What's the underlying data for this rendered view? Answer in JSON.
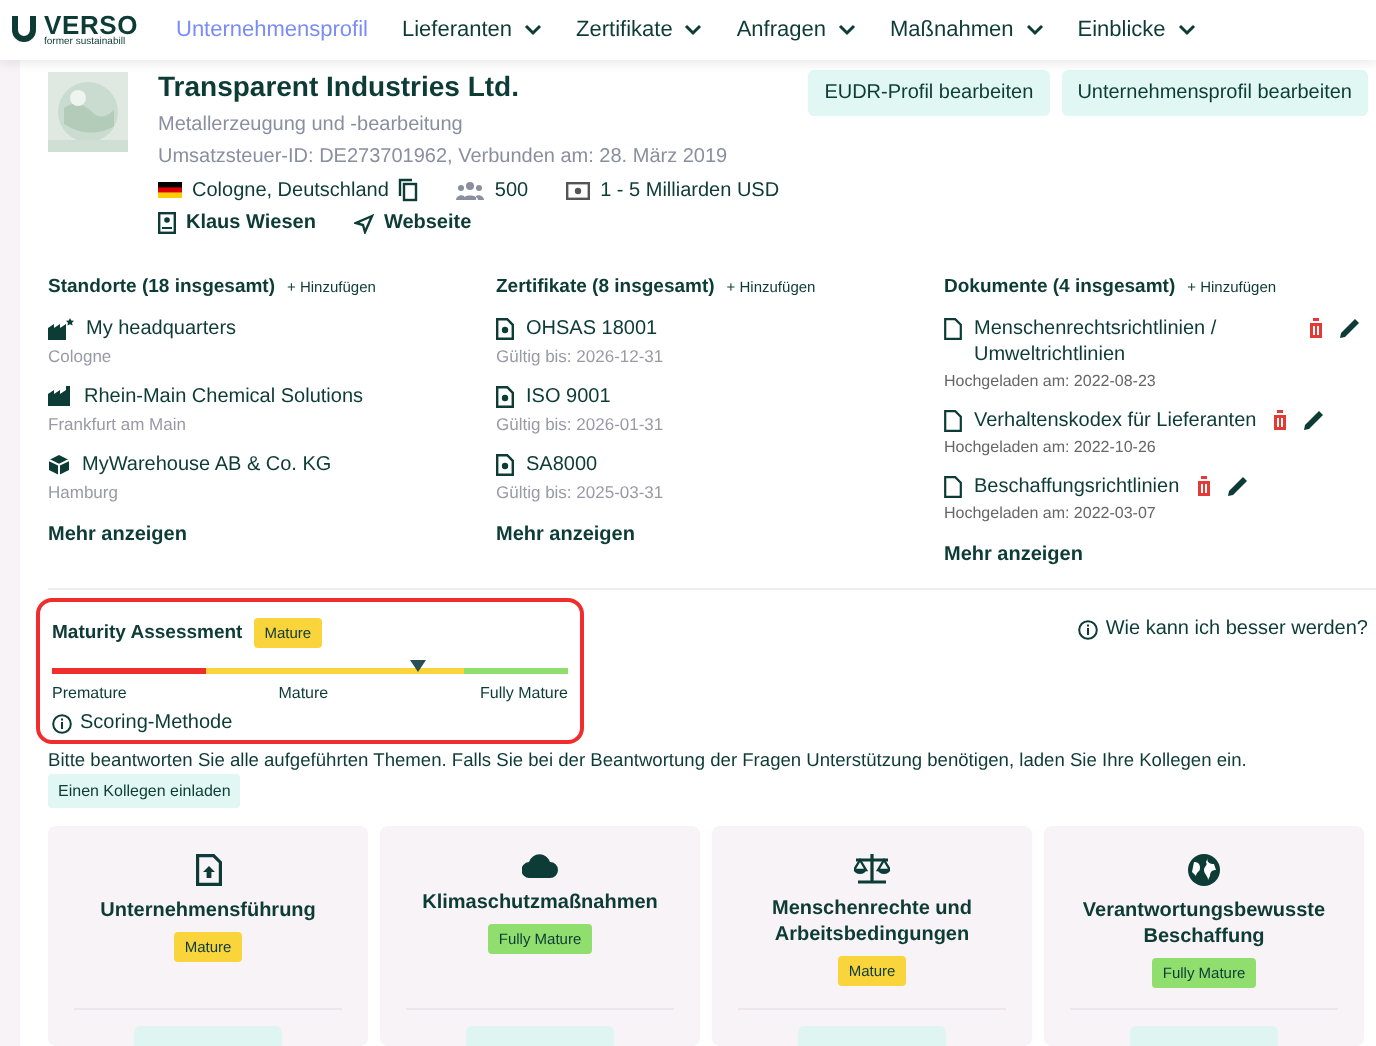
{
  "header": {
    "logo": "VERSO",
    "tagline": "former sustainabill",
    "nav": [
      {
        "label": "Unternehmensprofil",
        "selected": true,
        "dropdown": false
      },
      {
        "label": "Lieferanten",
        "selected": false,
        "dropdown": true
      },
      {
        "label": "Zertifikate",
        "selected": false,
        "dropdown": true
      },
      {
        "label": "Anfragen",
        "selected": false,
        "dropdown": true
      },
      {
        "label": "Maßnahmen",
        "selected": false,
        "dropdown": true
      },
      {
        "label": "Einblicke",
        "selected": false,
        "dropdown": true
      }
    ]
  },
  "company": {
    "name": "Transparent Industries Ltd.",
    "industry": "Metallerzeugung und -bearbeitung",
    "vat": "Umsatzsteuer-ID: DE273701962, Verbunden am: 28. März 2019",
    "location": "Cologne, Deutschland",
    "employees": "500",
    "revenue": "1 - 5 Milliarden USD",
    "contact": "Klaus Wiesen",
    "website": "Webseite",
    "buttons": [
      "EUDR-Profil bearbeiten",
      "Unternehmensprofil bearbeiten"
    ]
  },
  "sections": [
    {
      "kind": "locations",
      "title": "Standorte (18 insgesamt)",
      "add": "+ Hinzufügen",
      "more": "Mehr anzeigen",
      "items": [
        {
          "kind": "headquarters",
          "name": "My headquarters",
          "sub": "Cologne"
        },
        {
          "kind": "factory",
          "name": "Rhein-Main Chemical Solutions",
          "sub": "Frankfurt am Main"
        },
        {
          "kind": "warehouse",
          "name": "MyWarehouse AB & Co. KG",
          "sub": "Hamburg"
        }
      ]
    },
    {
      "kind": "certificates",
      "title": "Zertifikate (8 insgesamt)",
      "add": "+ Hinzufügen",
      "more": "Mehr anzeigen",
      "items": [
        {
          "kind": "certificate",
          "name": "OHSAS 18001",
          "sub": "Gültig bis: 2026-12-31"
        },
        {
          "kind": "certificate",
          "name": "ISO 9001",
          "sub": "Gültig bis: 2026-01-31"
        },
        {
          "kind": "certificate",
          "name": "SA8000",
          "sub": "Gültig bis: 2025-03-31"
        }
      ]
    },
    {
      "kind": "documents",
      "title": "Dokumente (4 insgesamt)",
      "add": "+ Hinzufügen",
      "more": "Mehr anzeigen",
      "items": [
        {
          "kind": "document",
          "name": "Menschenrechtsrichtlinien / Umweltrichtlinien",
          "sub": "Hochgeladen am: 2022-08-23"
        },
        {
          "kind": "document",
          "name": "Verhaltenskodex für Lieferanten",
          "sub": "Hochgeladen am: 2022-10-26"
        },
        {
          "kind": "document",
          "name": "Beschaffungsrichtlinien",
          "sub": "Hochgeladen am: 2022-03-07"
        }
      ]
    }
  ],
  "maturity": {
    "title": "Maturity Assessment",
    "badge": {
      "label": "Mature",
      "kind": "mature"
    },
    "level": 0.71,
    "scale": [
      "Premature",
      "Mature",
      "Fully Mature"
    ],
    "method": "Scoring-Methode",
    "help": "Wie kann ich besser werden?"
  },
  "intro": "Bitte beantworten Sie alle aufgeführten Themen. Falls Sie bei der Beantwortung der Fragen Unterstützung benötigen, laden Sie Ihre Kollegen ein.",
  "invite": "Einen Kollegen einladen",
  "cards": [
    {
      "kind": "upload",
      "title": "Unternehmensführung",
      "badge": {
        "label": "Mature",
        "kind": "mature"
      }
    },
    {
      "kind": "cloud",
      "title": "Klimaschutzmaßnahmen",
      "badge": {
        "label": "Fully Mature",
        "kind": "fully"
      }
    },
    {
      "kind": "scale",
      "title": "Menschenrechte und Arbeitsbedingungen",
      "badge": {
        "label": "Mature",
        "kind": "mature"
      }
    },
    {
      "kind": "globe",
      "title": "Verantwortungsbewusste Beschaffung",
      "badge": {
        "label": "Fully Mature",
        "kind": "fully"
      }
    }
  ]
}
